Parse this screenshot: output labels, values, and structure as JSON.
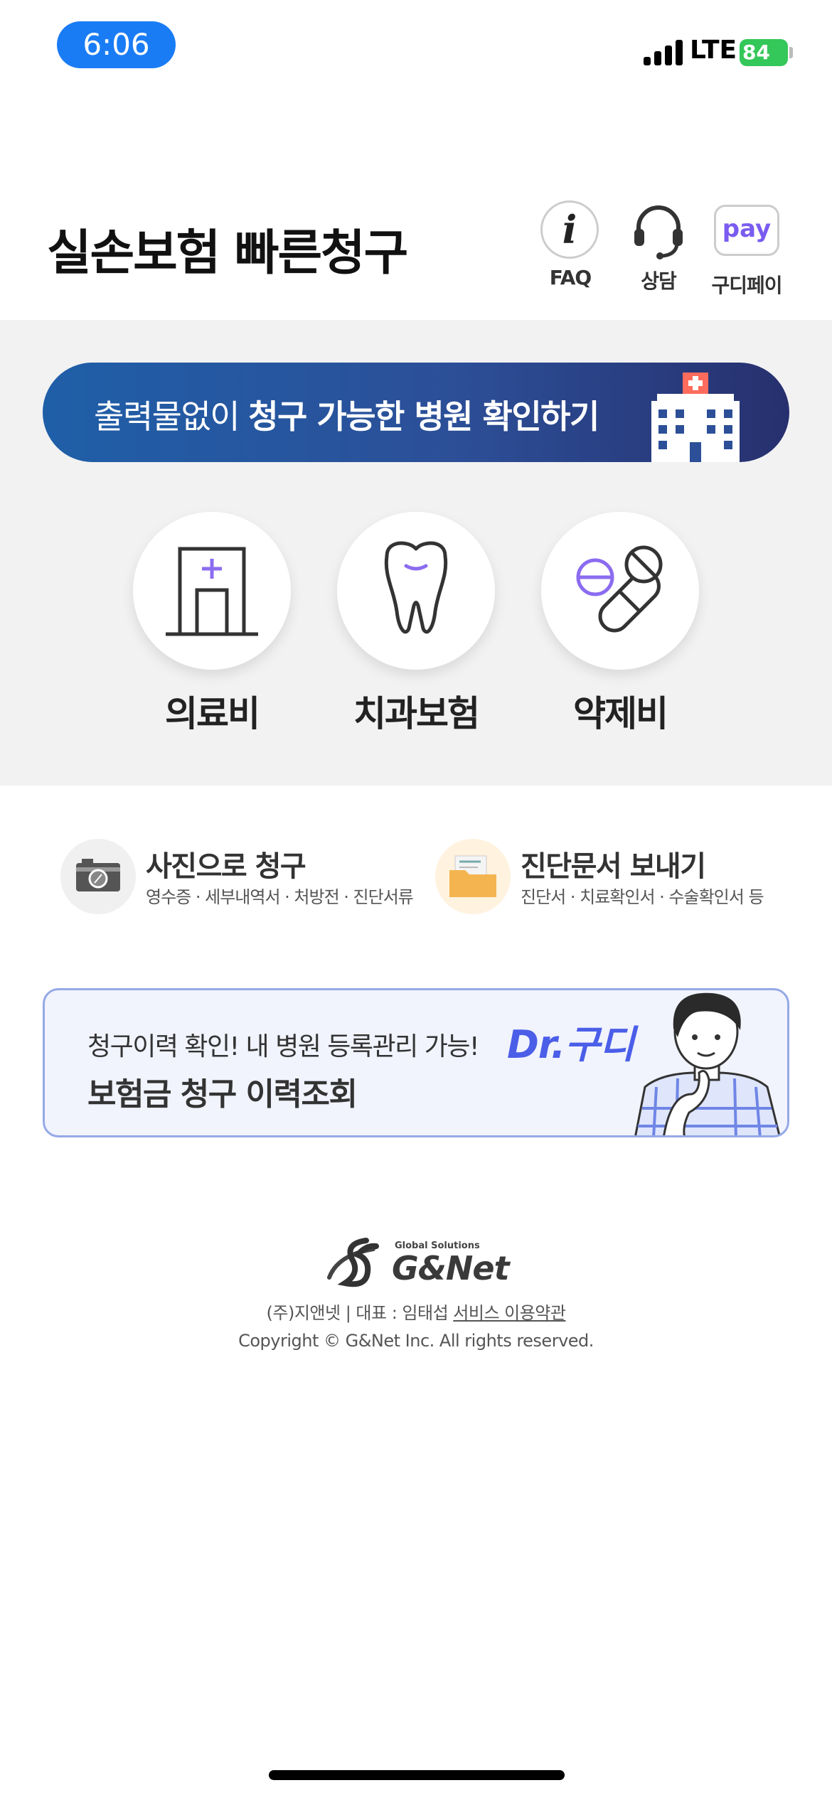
{
  "status_bar": {
    "time": "6:06",
    "network": "LTE",
    "battery": "84"
  },
  "header": {
    "title": "실손보험 빠른청구",
    "buttons": [
      {
        "label": "FAQ",
        "icon": "info-icon"
      },
      {
        "label": "상담",
        "icon": "headset-icon"
      },
      {
        "label": "구디페이",
        "icon": "pay-icon",
        "icon_text": "pay"
      }
    ]
  },
  "banner": {
    "text_normal": "출력물없이 ",
    "text_bold": "청구 가능한 병원 확인하기",
    "icon": "hospital-building-icon"
  },
  "categories": [
    {
      "label": "의료비",
      "icon": "hospital-door-icon"
    },
    {
      "label": "치과보험",
      "icon": "tooth-icon"
    },
    {
      "label": "약제비",
      "icon": "pills-icon"
    }
  ],
  "quick_actions": [
    {
      "title": "사진으로 청구",
      "subtitle": "영수증 · 세부내역서 · 처방전 · 진단서류",
      "icon": "camera-icon"
    },
    {
      "title": "진단문서 보내기",
      "subtitle": "진단서 · 치료확인서 · 수술확인서 등",
      "icon": "folder-icon"
    }
  ],
  "dr_card": {
    "line1": "청구이력 확인! 내 병원 등록관리 가능!",
    "line2": "보험금 청구 이력조회",
    "brand": "Dr.구디"
  },
  "footer": {
    "logo_sub": "Global Solutions",
    "logo_main": "G&Net",
    "company": "(주)지앤넷 | 대표 : 임태섭 ",
    "terms_link": "서비스 이용약관",
    "copyright": "Copyright © G&Net Inc. All rights reserved."
  },
  "colors": {
    "accent": "#1a7cf5",
    "banner": "#2c4f98",
    "brand_purple": "#7a5cf0",
    "dr_border": "#95a9e6"
  }
}
